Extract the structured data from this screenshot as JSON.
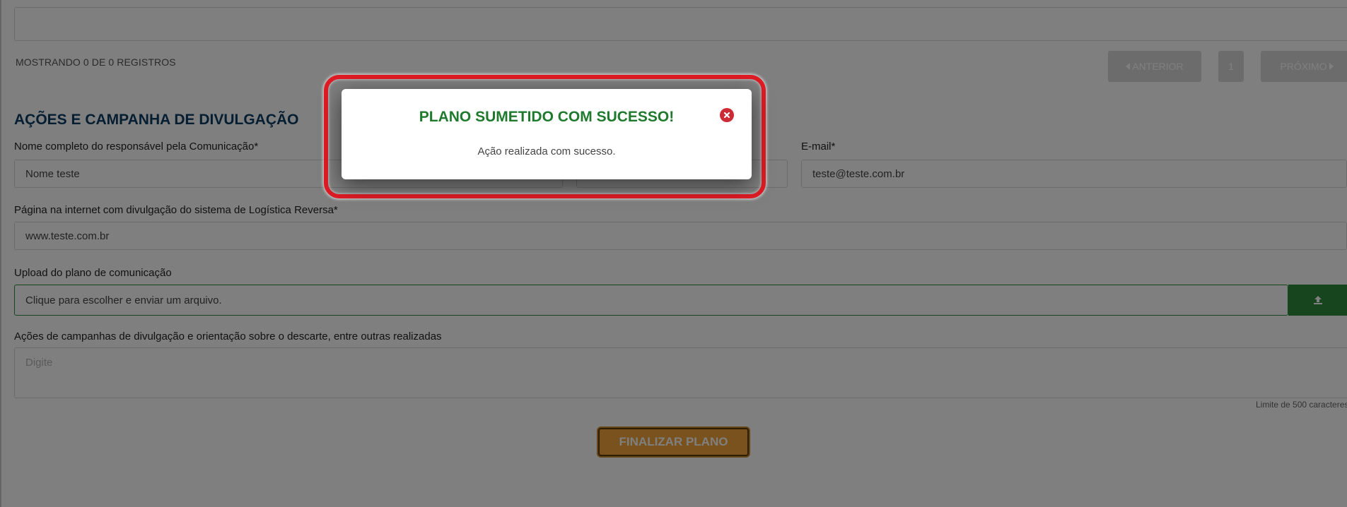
{
  "table": {
    "showing_text": "MOSTRANDO 0 DE 0 REGISTROS",
    "prev_label": "ANTERIOR",
    "page_number": "1",
    "next_label": "PRÓXIMO"
  },
  "section": {
    "title": "AÇÕES E CAMPANHA DE DIVULGAÇÃO"
  },
  "form": {
    "responsible_label": "Nome completo do responsável pela Comunicação*",
    "responsible_value": "Nome teste",
    "email_label": "E-mail*",
    "email_value": "teste@teste.com.br",
    "website_label": "Página na internet com divulgação do sistema de Logística Reversa*",
    "website_value": "www.teste.com.br",
    "upload_label": "Upload do plano de comunicação",
    "upload_placeholder": "Clique para escolher e enviar um arquivo.",
    "actions_label": "Ações de campanhas de divulgação e orientação sobre o descarte, entre outras realizadas",
    "actions_placeholder": "Digite",
    "limit_text": "Limite de 500 caracteres",
    "finalize_label": "FINALIZAR PLANO"
  },
  "modal": {
    "title": "PLANO SUMETIDO COM SUCESSO!",
    "message": "Ação realizada com sucesso."
  },
  "colors": {
    "success": "#1f7a2e",
    "error": "#cc2a36",
    "highlight": "#e01b24",
    "upload_button": "#2e8b3d",
    "finalize_button": "#f2a43a",
    "section_title": "#0a3d62"
  }
}
